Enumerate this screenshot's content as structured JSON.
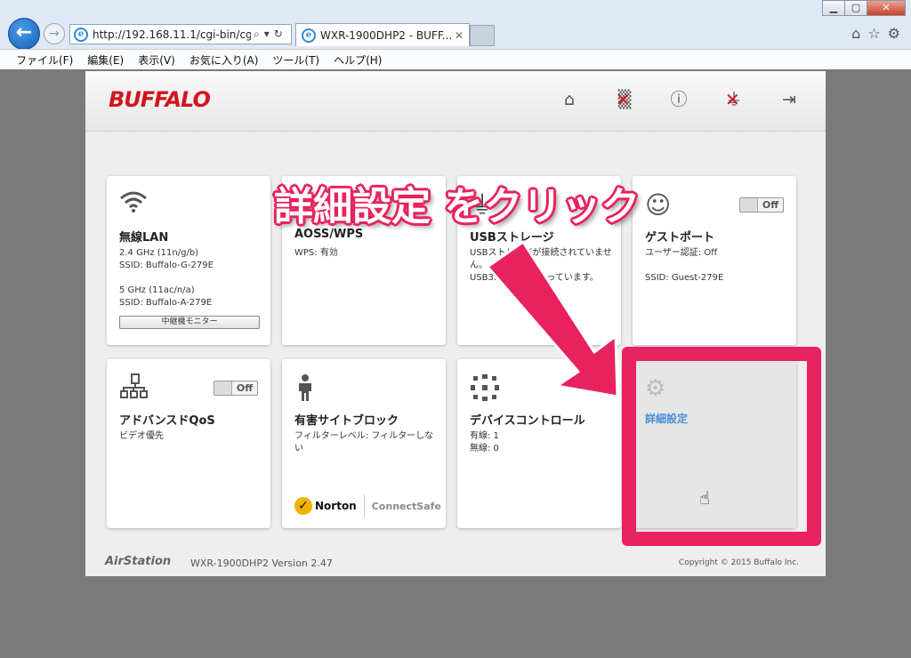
{
  "window": {
    "minimize": "▁",
    "maximize": "▢",
    "close": "✕"
  },
  "browser": {
    "url": "http://192.168.11.1/cgi-bin/cg",
    "tab_title": "WXR-1900DHP2 - BUFF...",
    "menu": [
      "ファイル(F)",
      "編集(E)",
      "表示(V)",
      "お気に入り(A)",
      "ツール(T)",
      "ヘルプ(H)"
    ],
    "icons": [
      "home-icon",
      "star-icon",
      "gear-icon"
    ]
  },
  "router": {
    "logo": "BUFFALO",
    "header_icons": [
      "home-icon",
      "wireless-disabled-icon",
      "info-icon",
      "usb-disabled-icon",
      "logout-icon"
    ],
    "cards": {
      "wireless": {
        "title": "無線LAN",
        "lines": [
          "2.4 GHz (11n/g/b)",
          "SSID: Buffalo-G-279E",
          "",
          "5 GHz (11ac/n/a)",
          "SSID: Buffalo-A-279E"
        ],
        "button": "中継機モニター"
      },
      "aoss": {
        "title": "AOSS/WPS",
        "lines": [
          "WPS: 有効"
        ]
      },
      "usb": {
        "title": "USBストレージ",
        "lines": [
          "USBストレージが接続されていません。",
          "USB3.0は無効になっています。"
        ]
      },
      "guest": {
        "title": "ゲストポート",
        "toggle": "Off",
        "lines": [
          "ユーザー認証: Off",
          "",
          "SSID: Guest-279E"
        ]
      },
      "qos": {
        "title": "アドバンスドQoS",
        "toggle": "Off",
        "lines": [
          "ビデオ優先"
        ]
      },
      "block": {
        "title": "有害サイトブロック",
        "lines": [
          "フィルターレベル: フィルターしない"
        ],
        "norton": "Norton",
        "norton_sub": "ConnectSafe"
      },
      "device": {
        "title": "デバイスコントロール",
        "lines": [
          "有線: 1",
          "無線: 0"
        ]
      },
      "advanced": {
        "title": "詳細設定"
      }
    },
    "footer": {
      "logo": "AirStation",
      "model": "WXR-1900DHP2   Version 2.47",
      "copyright": "Copyright © 2015 Buffalo Inc."
    }
  },
  "annotation": {
    "callout": "詳細設定 をクリック",
    "color": "#e8225e"
  }
}
